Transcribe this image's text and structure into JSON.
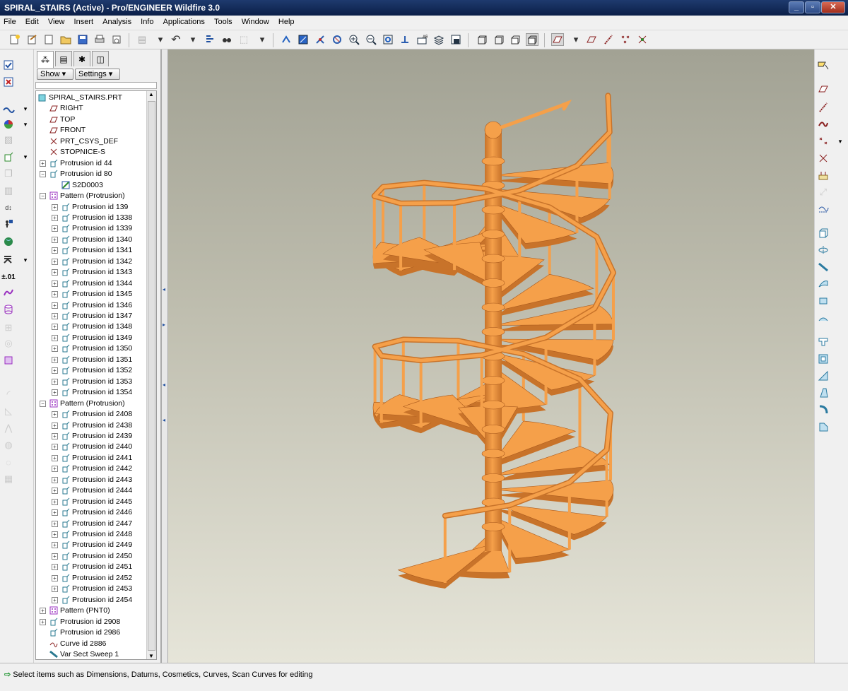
{
  "window": {
    "title": "SPIRAL_STAIRS (Active) - Pro/ENGINEER Wildfire 3.0",
    "controls": [
      "_",
      "▫",
      "✕"
    ]
  },
  "menu": [
    "File",
    "Edit",
    "View",
    "Insert",
    "Analysis",
    "Info",
    "Applications",
    "Tools",
    "Window",
    "Help"
  ],
  "panel": {
    "show_label": "Show ▾",
    "settings_label": "Settings ▾"
  },
  "tree": {
    "root": "SPIRAL_STAIRS.PRT",
    "datums": [
      "RIGHT",
      "TOP",
      "FRONT",
      "PRT_CSYS_DEF",
      "STOPNICE-S"
    ],
    "prot44": "Protrusion id 44",
    "prot80": "Protrusion id 80",
    "sketch": "S2D0003",
    "pattern1": "Pattern (Protrusion)",
    "pattern1_items": [
      "Protrusion id 139",
      "Protrusion id 1338",
      "Protrusion id 1339",
      "Protrusion id 1340",
      "Protrusion id 1341",
      "Protrusion id 1342",
      "Protrusion id 1343",
      "Protrusion id 1344",
      "Protrusion id 1345",
      "Protrusion id 1346",
      "Protrusion id 1347",
      "Protrusion id 1348",
      "Protrusion id 1349",
      "Protrusion id 1350",
      "Protrusion id 1351",
      "Protrusion id 1352",
      "Protrusion id 1353",
      "Protrusion id 1354"
    ],
    "pattern2": "Pattern (Protrusion)",
    "pattern2_items": [
      "Protrusion id 2408",
      "Protrusion id 2438",
      "Protrusion id 2439",
      "Protrusion id 2440",
      "Protrusion id 2441",
      "Protrusion id 2442",
      "Protrusion id 2443",
      "Protrusion id 2444",
      "Protrusion id 2445",
      "Protrusion id 2446",
      "Protrusion id 2447",
      "Protrusion id 2448",
      "Protrusion id 2449",
      "Protrusion id 2450",
      "Protrusion id 2451",
      "Protrusion id 2452",
      "Protrusion id 2453",
      "Protrusion id 2454"
    ],
    "pattern3": "Pattern (PNT0)",
    "prot2908": "Protrusion id 2908",
    "prot2986": "Protrusion id 2986",
    "curve": "Curve id 2886",
    "sweep": "Var Sect Sweep 1"
  },
  "status": {
    "message": "Select items such as Dimensions, Datums, Cosmetics, Curves, Scan Curves for editing"
  },
  "colors": {
    "model": "#f5a04a",
    "model_shadow": "#c8732a",
    "model_edge": "#a9591c"
  }
}
